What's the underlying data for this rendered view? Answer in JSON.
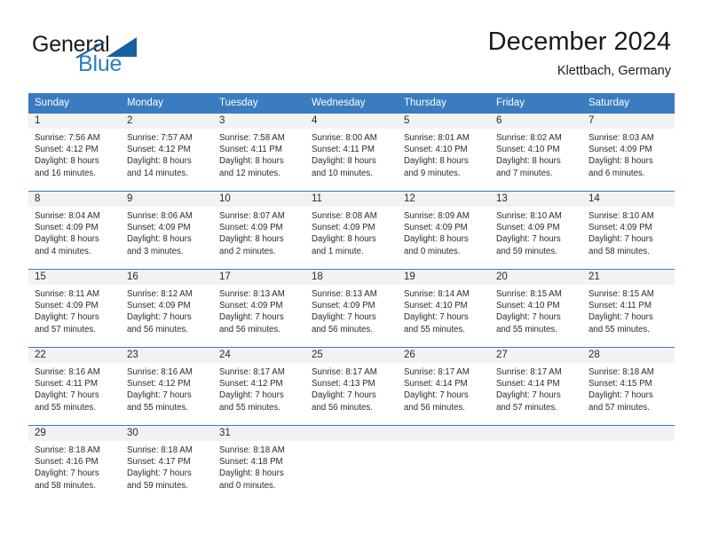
{
  "logo": {
    "word_one": "General",
    "word_two": "Blue",
    "triangle_icon": "triangle-icon"
  },
  "header": {
    "month_title": "December 2024",
    "location": "Klettbach, Germany"
  },
  "theme": {
    "header_blue": "#3a7cbf",
    "daynum_band": "#f2f2f2",
    "logo_blue": "#2b7fc4",
    "logo_dark_blue": "#16609e",
    "text": "#2b2b2b"
  },
  "calendar": {
    "weekday_headers": [
      "Sunday",
      "Monday",
      "Tuesday",
      "Wednesday",
      "Thursday",
      "Friday",
      "Saturday"
    ],
    "weeks": [
      [
        {
          "day": "1",
          "sunrise": "Sunrise: 7:56 AM",
          "sunset": "Sunset: 4:12 PM",
          "daylight_1": "Daylight: 8 hours",
          "daylight_2": "and 16 minutes."
        },
        {
          "day": "2",
          "sunrise": "Sunrise: 7:57 AM",
          "sunset": "Sunset: 4:12 PM",
          "daylight_1": "Daylight: 8 hours",
          "daylight_2": "and 14 minutes."
        },
        {
          "day": "3",
          "sunrise": "Sunrise: 7:58 AM",
          "sunset": "Sunset: 4:11 PM",
          "daylight_1": "Daylight: 8 hours",
          "daylight_2": "and 12 minutes."
        },
        {
          "day": "4",
          "sunrise": "Sunrise: 8:00 AM",
          "sunset": "Sunset: 4:11 PM",
          "daylight_1": "Daylight: 8 hours",
          "daylight_2": "and 10 minutes."
        },
        {
          "day": "5",
          "sunrise": "Sunrise: 8:01 AM",
          "sunset": "Sunset: 4:10 PM",
          "daylight_1": "Daylight: 8 hours",
          "daylight_2": "and 9 minutes."
        },
        {
          "day": "6",
          "sunrise": "Sunrise: 8:02 AM",
          "sunset": "Sunset: 4:10 PM",
          "daylight_1": "Daylight: 8 hours",
          "daylight_2": "and 7 minutes."
        },
        {
          "day": "7",
          "sunrise": "Sunrise: 8:03 AM",
          "sunset": "Sunset: 4:09 PM",
          "daylight_1": "Daylight: 8 hours",
          "daylight_2": "and 6 minutes."
        }
      ],
      [
        {
          "day": "8",
          "sunrise": "Sunrise: 8:04 AM",
          "sunset": "Sunset: 4:09 PM",
          "daylight_1": "Daylight: 8 hours",
          "daylight_2": "and 4 minutes."
        },
        {
          "day": "9",
          "sunrise": "Sunrise: 8:06 AM",
          "sunset": "Sunset: 4:09 PM",
          "daylight_1": "Daylight: 8 hours",
          "daylight_2": "and 3 minutes."
        },
        {
          "day": "10",
          "sunrise": "Sunrise: 8:07 AM",
          "sunset": "Sunset: 4:09 PM",
          "daylight_1": "Daylight: 8 hours",
          "daylight_2": "and 2 minutes."
        },
        {
          "day": "11",
          "sunrise": "Sunrise: 8:08 AM",
          "sunset": "Sunset: 4:09 PM",
          "daylight_1": "Daylight: 8 hours",
          "daylight_2": "and 1 minute."
        },
        {
          "day": "12",
          "sunrise": "Sunrise: 8:09 AM",
          "sunset": "Sunset: 4:09 PM",
          "daylight_1": "Daylight: 8 hours",
          "daylight_2": "and 0 minutes."
        },
        {
          "day": "13",
          "sunrise": "Sunrise: 8:10 AM",
          "sunset": "Sunset: 4:09 PM",
          "daylight_1": "Daylight: 7 hours",
          "daylight_2": "and 59 minutes."
        },
        {
          "day": "14",
          "sunrise": "Sunrise: 8:10 AM",
          "sunset": "Sunset: 4:09 PM",
          "daylight_1": "Daylight: 7 hours",
          "daylight_2": "and 58 minutes."
        }
      ],
      [
        {
          "day": "15",
          "sunrise": "Sunrise: 8:11 AM",
          "sunset": "Sunset: 4:09 PM",
          "daylight_1": "Daylight: 7 hours",
          "daylight_2": "and 57 minutes."
        },
        {
          "day": "16",
          "sunrise": "Sunrise: 8:12 AM",
          "sunset": "Sunset: 4:09 PM",
          "daylight_1": "Daylight: 7 hours",
          "daylight_2": "and 56 minutes."
        },
        {
          "day": "17",
          "sunrise": "Sunrise: 8:13 AM",
          "sunset": "Sunset: 4:09 PM",
          "daylight_1": "Daylight: 7 hours",
          "daylight_2": "and 56 minutes."
        },
        {
          "day": "18",
          "sunrise": "Sunrise: 8:13 AM",
          "sunset": "Sunset: 4:09 PM",
          "daylight_1": "Daylight: 7 hours",
          "daylight_2": "and 56 minutes."
        },
        {
          "day": "19",
          "sunrise": "Sunrise: 8:14 AM",
          "sunset": "Sunset: 4:10 PM",
          "daylight_1": "Daylight: 7 hours",
          "daylight_2": "and 55 minutes."
        },
        {
          "day": "20",
          "sunrise": "Sunrise: 8:15 AM",
          "sunset": "Sunset: 4:10 PM",
          "daylight_1": "Daylight: 7 hours",
          "daylight_2": "and 55 minutes."
        },
        {
          "day": "21",
          "sunrise": "Sunrise: 8:15 AM",
          "sunset": "Sunset: 4:11 PM",
          "daylight_1": "Daylight: 7 hours",
          "daylight_2": "and 55 minutes."
        }
      ],
      [
        {
          "day": "22",
          "sunrise": "Sunrise: 8:16 AM",
          "sunset": "Sunset: 4:11 PM",
          "daylight_1": "Daylight: 7 hours",
          "daylight_2": "and 55 minutes."
        },
        {
          "day": "23",
          "sunrise": "Sunrise: 8:16 AM",
          "sunset": "Sunset: 4:12 PM",
          "daylight_1": "Daylight: 7 hours",
          "daylight_2": "and 55 minutes."
        },
        {
          "day": "24",
          "sunrise": "Sunrise: 8:17 AM",
          "sunset": "Sunset: 4:12 PM",
          "daylight_1": "Daylight: 7 hours",
          "daylight_2": "and 55 minutes."
        },
        {
          "day": "25",
          "sunrise": "Sunrise: 8:17 AM",
          "sunset": "Sunset: 4:13 PM",
          "daylight_1": "Daylight: 7 hours",
          "daylight_2": "and 56 minutes."
        },
        {
          "day": "26",
          "sunrise": "Sunrise: 8:17 AM",
          "sunset": "Sunset: 4:14 PM",
          "daylight_1": "Daylight: 7 hours",
          "daylight_2": "and 56 minutes."
        },
        {
          "day": "27",
          "sunrise": "Sunrise: 8:17 AM",
          "sunset": "Sunset: 4:14 PM",
          "daylight_1": "Daylight: 7 hours",
          "daylight_2": "and 57 minutes."
        },
        {
          "day": "28",
          "sunrise": "Sunrise: 8:18 AM",
          "sunset": "Sunset: 4:15 PM",
          "daylight_1": "Daylight: 7 hours",
          "daylight_2": "and 57 minutes."
        }
      ],
      [
        {
          "day": "29",
          "sunrise": "Sunrise: 8:18 AM",
          "sunset": "Sunset: 4:16 PM",
          "daylight_1": "Daylight: 7 hours",
          "daylight_2": "and 58 minutes."
        },
        {
          "day": "30",
          "sunrise": "Sunrise: 8:18 AM",
          "sunset": "Sunset: 4:17 PM",
          "daylight_1": "Daylight: 7 hours",
          "daylight_2": "and 59 minutes."
        },
        {
          "day": "31",
          "sunrise": "Sunrise: 8:18 AM",
          "sunset": "Sunset: 4:18 PM",
          "daylight_1": "Daylight: 8 hours",
          "daylight_2": "and 0 minutes."
        },
        {
          "day": "",
          "sunrise": "",
          "sunset": "",
          "daylight_1": "",
          "daylight_2": ""
        },
        {
          "day": "",
          "sunrise": "",
          "sunset": "",
          "daylight_1": "",
          "daylight_2": ""
        },
        {
          "day": "",
          "sunrise": "",
          "sunset": "",
          "daylight_1": "",
          "daylight_2": ""
        },
        {
          "day": "",
          "sunrise": "",
          "sunset": "",
          "daylight_1": "",
          "daylight_2": ""
        }
      ]
    ]
  }
}
